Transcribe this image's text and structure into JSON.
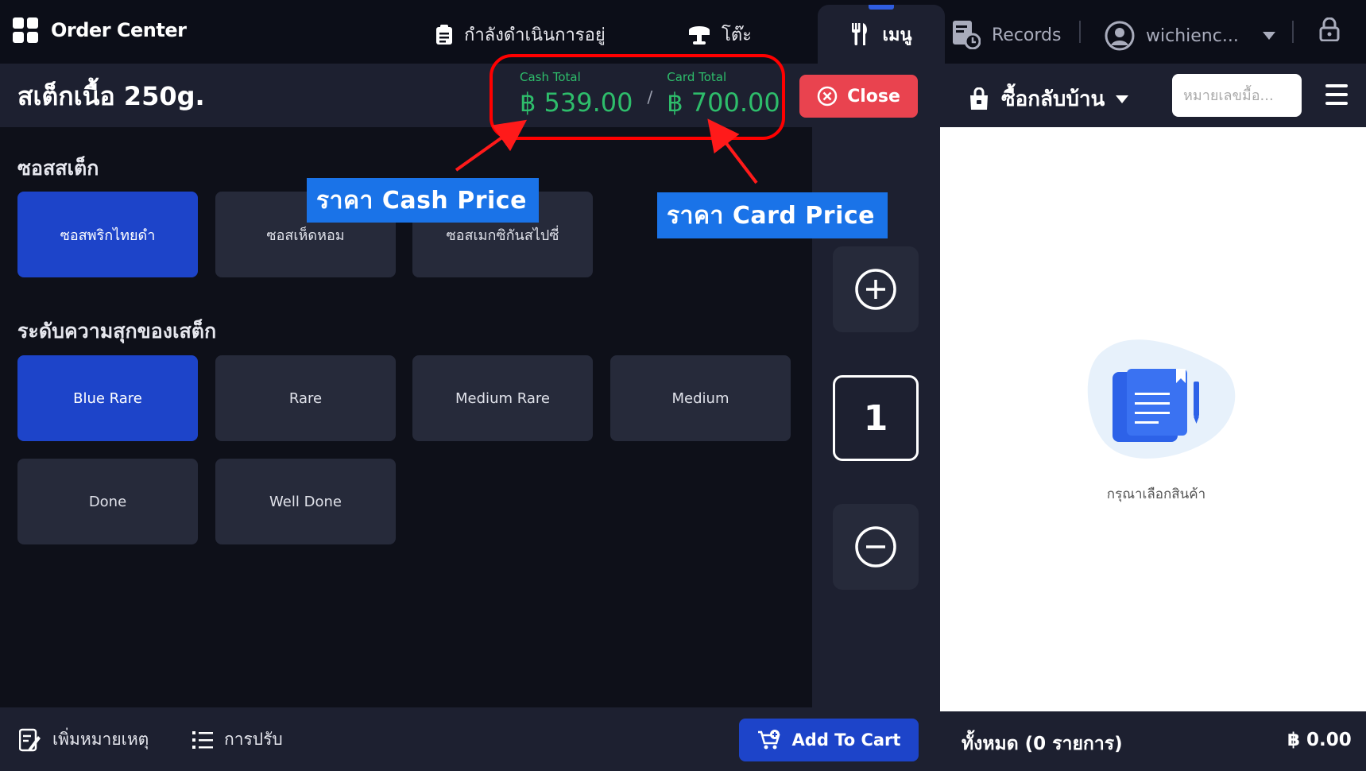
{
  "header": {
    "app_title": "Order Center",
    "tabs": [
      {
        "label": "กำลังดำเนินการอยู่",
        "icon": "clipboard-icon"
      },
      {
        "label": "โต๊ะ",
        "icon": "table-icon"
      },
      {
        "label": "เมนู",
        "icon": "utensils-icon",
        "active": true
      },
      {
        "label": "Records",
        "icon": "records-icon"
      }
    ],
    "username": "wichienc...",
    "accent_color": "#2f5de0"
  },
  "product": {
    "title": "สเต็กเนื้อ 250g.",
    "cash_total_label": "Cash Total",
    "cash_total_value": "฿ 539.00",
    "separator": "/",
    "card_total_label": "Card Total",
    "card_total_value": "฿ 700.00",
    "close_label": "Close"
  },
  "order_type": {
    "label": "ซื้อกลับบ้าน",
    "order_number_placeholder": "หมายเลขมื้อ..."
  },
  "sections": {
    "sauce": {
      "title": "ซอสสเต็ก",
      "options": [
        "ซอสพริกไทยดำ",
        "ซอสเห็ดหอม",
        "ซอสเมกซิกันสไปซี่"
      ],
      "selected": 0
    },
    "doneness": {
      "title": "ระดับความสุกของเสต็ก",
      "options": [
        "Blue Rare",
        "Rare",
        "Medium Rare",
        "Medium",
        "Done",
        "Well Done"
      ],
      "selected": 0
    }
  },
  "quantity": {
    "value": "1"
  },
  "cart": {
    "empty_text": "กรุณาเลือกสินค้า",
    "total_label": "ทั้งหมด (0 รายการ)",
    "total_value": "฿ 0.00"
  },
  "bottom": {
    "add_note": "เพิ่มหมายเหตุ",
    "adjust": "การปรับ",
    "add_to_cart": "Add To Cart"
  },
  "annotations": {
    "cash_price": "ราคา Cash Price",
    "card_price": "ราคา Card Price",
    "highlight_color": "#ff0000"
  }
}
